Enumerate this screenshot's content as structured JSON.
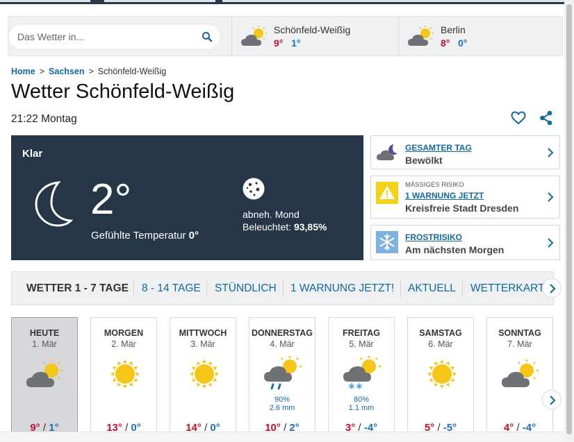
{
  "search": {
    "placeholder": "Das Wetter in..."
  },
  "locations": [
    {
      "name": "Schönfeld-Weißig",
      "high": "9°",
      "low": "1°",
      "icon": "partly-cloudy-icon"
    },
    {
      "name": "Berlin",
      "high": "8°",
      "low": "0°",
      "icon": "partly-cloudy-icon"
    }
  ],
  "breadcrumb": {
    "home": "Home",
    "region": "Sachsen",
    "current": "Schönfeld-Weißig",
    "separator": ">"
  },
  "page": {
    "title": "Wetter Schönfeld-Weißig",
    "time": "21:22 Montag"
  },
  "current": {
    "condition": "Klar",
    "temp": "2°",
    "feels_label": "Gefühlte Temperatur",
    "feels_value": "0°",
    "moon_phase": "abneh. Mond",
    "illuminated_label": "Beleuchtet:",
    "illuminated_value": "93,85%"
  },
  "info_cards": [
    {
      "title": "GESAMTER TAG",
      "sub": "Bewölkt",
      "icon": "cloudy-night-icon"
    },
    {
      "small": "MÄSSIGES RISIKO",
      "title": "1 WARNUNG JETZT",
      "sub": "Kreisfreie Stadt Dresden",
      "icon": "warning-icon"
    },
    {
      "title": "FROSTRISIKO",
      "sub": "Am nächsten Morgen",
      "icon": "snowflake-icon"
    }
  ],
  "tabs": [
    "WETTER 1 - 7 TAGE",
    "8 - 14 TAGE",
    "STÜNDLICH",
    "1 WARNUNG JETZT!",
    "AKTUELL",
    "WETTERKARTE"
  ],
  "days": [
    {
      "name": "HEUTE",
      "date": "1. Mär",
      "high": "9°",
      "low": "1°",
      "icon": "partly-cloudy-icon"
    },
    {
      "name": "MORGEN",
      "date": "2. Mär",
      "high": "13°",
      "low": "0°",
      "icon": "sun-icon"
    },
    {
      "name": "MITTWOCH",
      "date": "3. Mär",
      "high": "14°",
      "low": "0°",
      "icon": "sun-icon"
    },
    {
      "name": "DONNERSTAG",
      "date": "4. Mär",
      "high": "10°",
      "low": "2°",
      "icon": "rain-icon",
      "prob": "90%",
      "mm": "2.6 mm"
    },
    {
      "name": "FREITAG",
      "date": "5. Mär",
      "high": "3°",
      "low": "-4°",
      "icon": "snow-icon",
      "prob": "80%",
      "mm": "1.1 mm"
    },
    {
      "name": "SAMSTAG",
      "date": "6. Mär",
      "high": "5°",
      "low": "-5°",
      "icon": "sun-icon"
    },
    {
      "name": "SONNTAG",
      "date": "7. Mär",
      "high": "4°",
      "low": "-4°",
      "icon": "partly-cloudy-icon"
    }
  ],
  "colors": {
    "accent": "#13689c",
    "high": "#c8102e",
    "low": "#1c6fb8",
    "card_dark": "#253646"
  }
}
